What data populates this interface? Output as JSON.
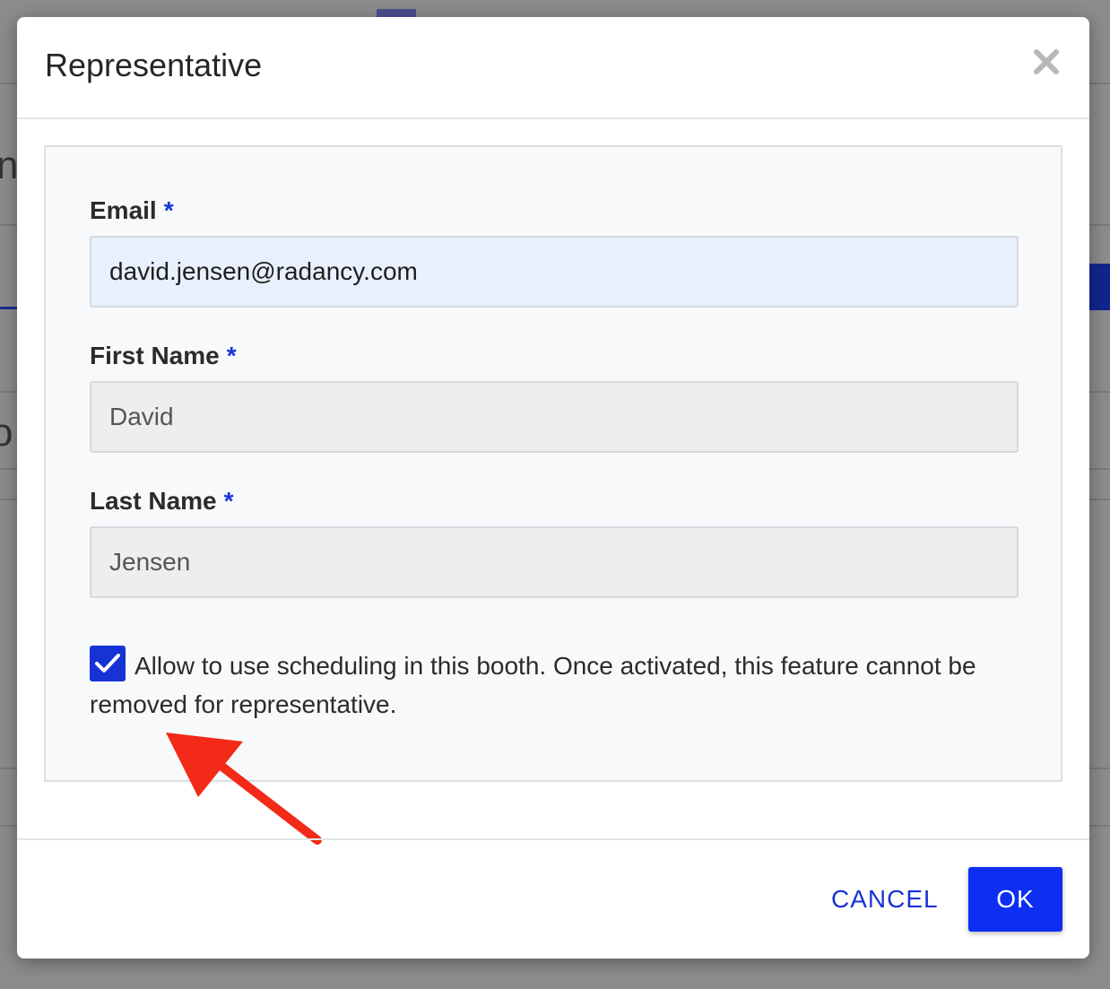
{
  "background": {
    "partial_glyph_top": "n",
    "partial_glyph_mid": "o"
  },
  "modal": {
    "title": "Representative",
    "close_icon": "close-icon",
    "fields": {
      "email": {
        "label": "Email",
        "required_mark": "*",
        "value": "david.jensen@radancy.com"
      },
      "first_name": {
        "label": "First Name",
        "required_mark": "*",
        "value": "David"
      },
      "last_name": {
        "label": "Last Name",
        "required_mark": "*",
        "value": "Jensen"
      }
    },
    "scheduling": {
      "checked": true,
      "label": "Allow to use scheduling in this booth. Once activated, this feature cannot be removed for representative."
    },
    "footer": {
      "cancel_label": "CANCEL",
      "ok_label": "OK"
    }
  },
  "colors": {
    "accent": "#1733d6",
    "ok_button": "#0d2ff2",
    "annotation_arrow": "#f22a17"
  }
}
